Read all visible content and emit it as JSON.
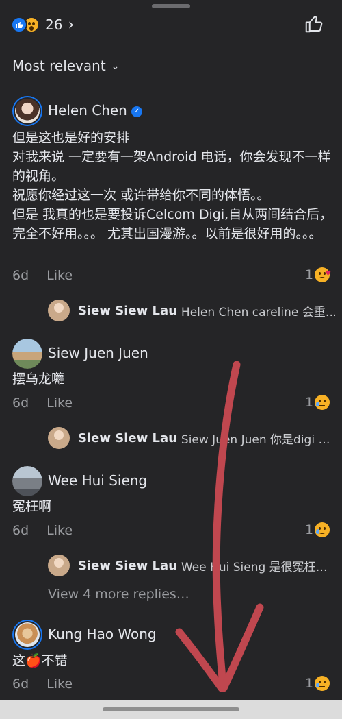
{
  "header": {
    "reaction_count": "26",
    "reaction_icons": [
      "like-icon",
      "wow-icon"
    ],
    "sort_label": "Most relevant"
  },
  "comments": [
    {
      "name": "Helen Chen",
      "verified": true,
      "text_lines": [
        "但是这也是好的安排",
        "对我来说 一定要有一架Android 电话，你会发现不一样的视角。",
        "祝愿你经过这一次 或许带给你不同的体悟。。",
        "但是 我真的也是要投诉Celcom Digi,自从两间结合后，完全不好用。。。 尤其出国漫游。。以前是很好用的。。。"
      ],
      "time": "6d",
      "like_label": "Like",
      "reaction_count": "1",
      "reaction_icon": "kiss-heart-emoji-icon",
      "reply": {
        "name": "Siew Siew Lau",
        "text": "Helen Chen careline 会重…"
      }
    },
    {
      "name": "Siew Juen Juen",
      "text_lines": [
        "摆乌龙囖"
      ],
      "time": "6d",
      "like_label": "Like",
      "reaction_count": "1",
      "reaction_icon": "sad-emoji-icon",
      "reply": {
        "name": "Siew Siew Lau",
        "text": "Siew Juen Juen 你是digi …"
      }
    },
    {
      "name": "Wee Hui Sieng",
      "text_lines": [
        "冤枉啊"
      ],
      "time": "6d",
      "like_label": "Like",
      "reaction_count": "1",
      "reaction_icon": "sad-emoji-icon",
      "reply": {
        "name": "Siew Siew Lau",
        "text": "Wee Hui Sieng 是很冤枉…"
      },
      "view_more": "View 4 more replies…"
    },
    {
      "name": "Kung Hao Wong",
      "text_lines": [
        "这🍎不错"
      ],
      "time": "6d",
      "like_label": "Like",
      "reaction_count": "1",
      "reaction_icon": "sad-emoji-icon"
    }
  ],
  "colors": {
    "background": "#252527",
    "text": "#e4e6eb",
    "muted": "#9a9ca0",
    "accent": "#1877f2",
    "annotation_arrow": "#c0474f"
  }
}
